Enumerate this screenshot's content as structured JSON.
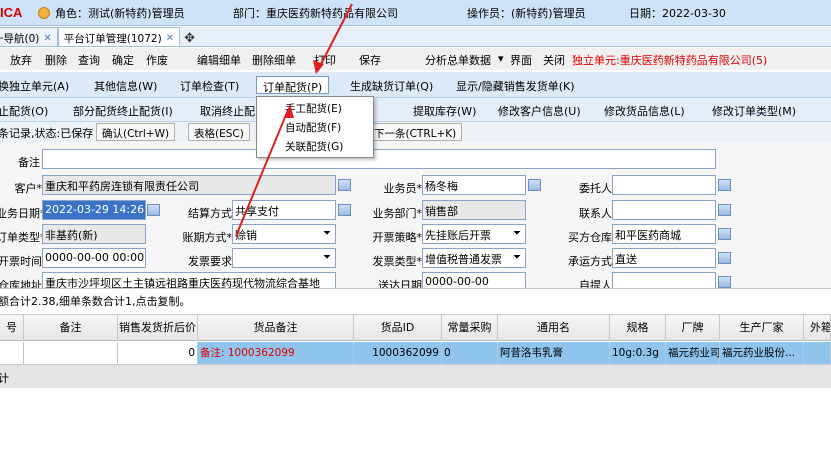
{
  "topbar": {
    "logo": "ICA",
    "role": "角色：测试(新特药)管理员",
    "dept": "部门：重庆医药新特药品有限公司",
    "operator": "操作员：(新特药)管理员",
    "date": "日期：2022-03-30"
  },
  "tabs": [
    {
      "label": "一导航(0)",
      "close": "✕"
    },
    {
      "label": "平台订单管理(1072)",
      "close": "✕"
    }
  ],
  "tab_add": "✥",
  "toolbar1": {
    "items": [
      "放弃",
      "删除",
      "查询",
      "确定",
      "作废",
      "编辑细单",
      "删除细单",
      "打印",
      "保存",
      "分析总单数据",
      "界面",
      "关闭"
    ],
    "dropdown_marker": "▾",
    "unit_label": "独立单元:重庆医药新特药品有限公司(5)"
  },
  "toolbar2": {
    "items": [
      "换独立单元(A)",
      "其他信息(W)",
      "订单检查(T)",
      "订单配货(P)",
      "生成缺货订单(Q)",
      "显示/隐藏销售发货单(K)"
    ]
  },
  "toolbar3": {
    "items": [
      "止配货(O)",
      "部分配货终止配货(I)",
      "取消终止配",
      "提取库存(W)",
      "修改客户信息(U)",
      "修改货品信息(L)",
      "修改订单类型(M)"
    ]
  },
  "toolbar4": {
    "status_prefix": "条记录,状态:已保存",
    "confirm": "确认(Ctrl+W)",
    "table": "表格(ESC)",
    "next": "下一条(CTRL+K)"
  },
  "popup": {
    "items": [
      "手工配货(E)",
      "自动配货(F)",
      "关联配货(G)"
    ]
  },
  "form": {
    "remark_label": "备注",
    "customer_label": "客户*",
    "customer_value": "重庆和平药房连锁有限责任公司",
    "salesman_label": "业务员*",
    "salesman_value": "杨冬梅",
    "entrust_label": "委托人",
    "bizdate_label": "业务日期*",
    "bizdate_value": "2022-03-29 14:26:13",
    "settle_label": "结算方式",
    "settle_value": "共享支付",
    "bizdept_label": "业务部门*",
    "bizdept_value": "销售部",
    "contact_label": "联系人",
    "ordertype_label": "订单类型*",
    "ordertype_value": "非基药(新)",
    "term_label": "账期方式*",
    "term_value": "赊销",
    "invpolicy_label": "开票策略*",
    "invpolicy_value": "先挂账后开票",
    "buyerwh_label": "买方仓库",
    "buyerwh_value": "和平医药商城",
    "invtime_label": "开票时间",
    "invtime_value": "0000-00-00 00:00:00",
    "invreq_label": "发票要求",
    "invtype_label": "发票类型*",
    "invtype_value": "增值税普通发票",
    "transport_label": "承运方式",
    "transport_value": "直送",
    "whaddr_label": "仓库地址",
    "whaddr_value": "重庆市沙坪坝区土主镇远祖路重庆医药现代物流综合基地",
    "arrival_label": "送达日期",
    "arrival_value": "0000-00-00",
    "pickup_label": "自提人"
  },
  "status": "额合计2.38,细单条数合计1,点击复制。",
  "grid": {
    "headers": [
      "号",
      "备注",
      "销售发货折后价",
      "货品备注",
      "货品ID",
      "常量采购",
      "通用名",
      "规格",
      "厂牌",
      "生产厂家",
      "外箱"
    ],
    "row": {
      "price": "0",
      "goods_remark": "备注: 1000362099",
      "goods_id": "1000362099",
      "purchase": "0",
      "generic_name": "阿昔洛韦乳膏",
      "spec": "10g:0.3g",
      "brand": "福元药业司",
      "maker": "福元药业股份..."
    },
    "total_label": "计"
  }
}
